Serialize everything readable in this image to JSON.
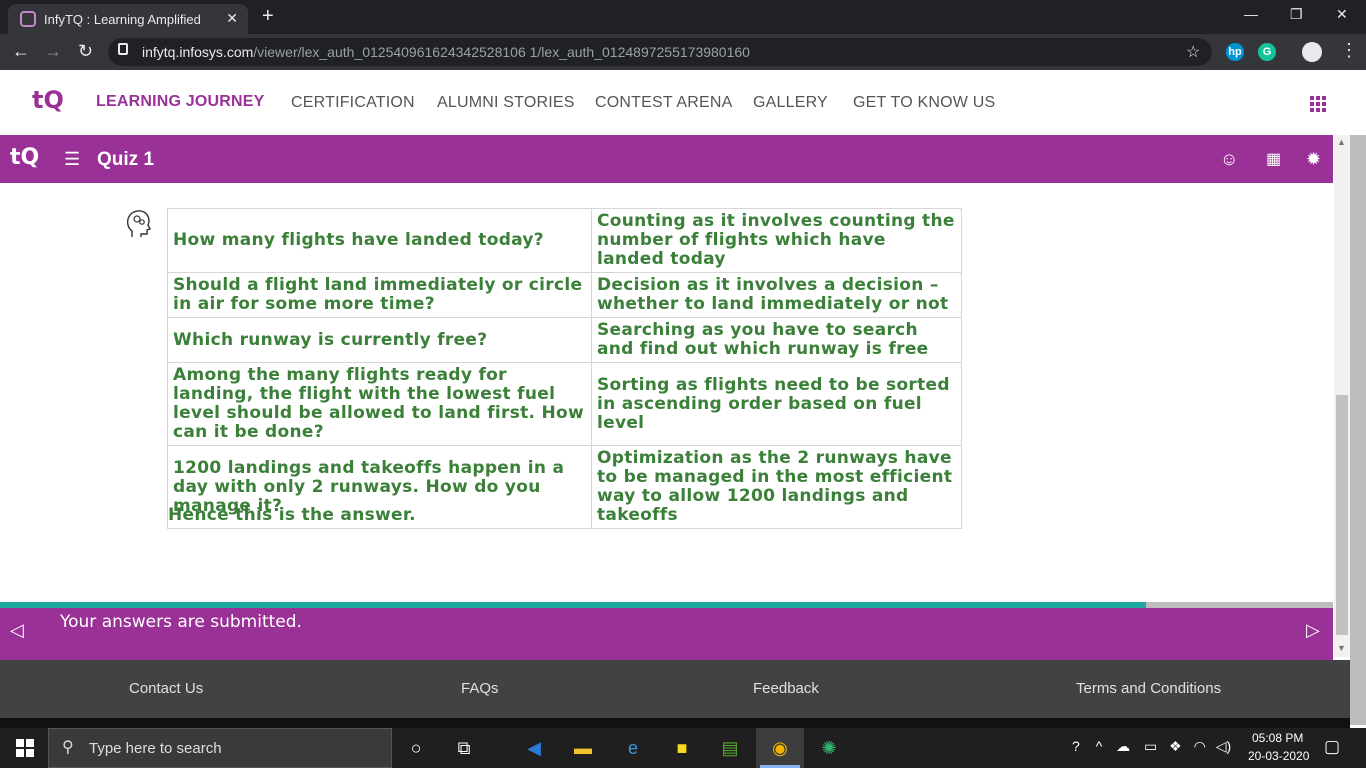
{
  "browser": {
    "tab_title": "InfyTQ : Learning Amplified",
    "tab_close": "✕",
    "new_tab": "+",
    "url_host": "infytq.infosys.com",
    "url_path": "/viewer/lex_auth_012540961624342528106 1/lex_auth_0124897255173980160",
    "window_minimize": "—",
    "window_restore": "❐",
    "window_close": "✕",
    "ext_hp": "hp",
    "ext_grammarly": "G"
  },
  "site_nav": {
    "items": [
      "LEARNING JOURNEY",
      "CERTIFICATION",
      "ALUMNI STORIES",
      "CONTEST ARENA",
      "GALLERY",
      "GET TO KNOW US"
    ],
    "logo": "tQ"
  },
  "quiz": {
    "title": "Quiz 1",
    "logo": "tQ"
  },
  "table": {
    "rows": [
      {
        "question": "How many flights have landed today?",
        "answer": "Counting as it involves counting the number of flights which have landed today"
      },
      {
        "question": "Should a flight land immediately or circle in air for some more time?",
        "answer": "Decision as it involves a decision – whether to land immediately or not"
      },
      {
        "question": "Which runway is currently free?",
        "answer": "Searching as you have to search and find out which runway is free"
      },
      {
        "question": "Among the many flights ready for landing, the flight with the lowest fuel level should be allowed to land first. How can it be done?",
        "answer": "Sorting as flights need to be sorted in ascending order based on fuel level"
      },
      {
        "question": "1200 landings and takeoffs happen in a day with only 2 runways. How do you manage it?",
        "answer": "Optimization as the 2 runways have to be managed in the most efficient way to allow 1200 landings and takeoffs"
      }
    ]
  },
  "hence_text": "Hence this is the answer.",
  "submission": {
    "message": "Your answers are submitted.",
    "progress_fraction": 0.86
  },
  "footer": {
    "links": [
      "Contact Us",
      "FAQs",
      "Feedback",
      "Terms and Conditions"
    ]
  },
  "taskbar": {
    "search_placeholder": "Type here to search",
    "time": "05:08 PM",
    "date": "20-03-2020"
  },
  "colors": {
    "brand_purple": "#9a3197",
    "answer_green": "#3b8039",
    "progress_teal": "#1fa8a0"
  }
}
